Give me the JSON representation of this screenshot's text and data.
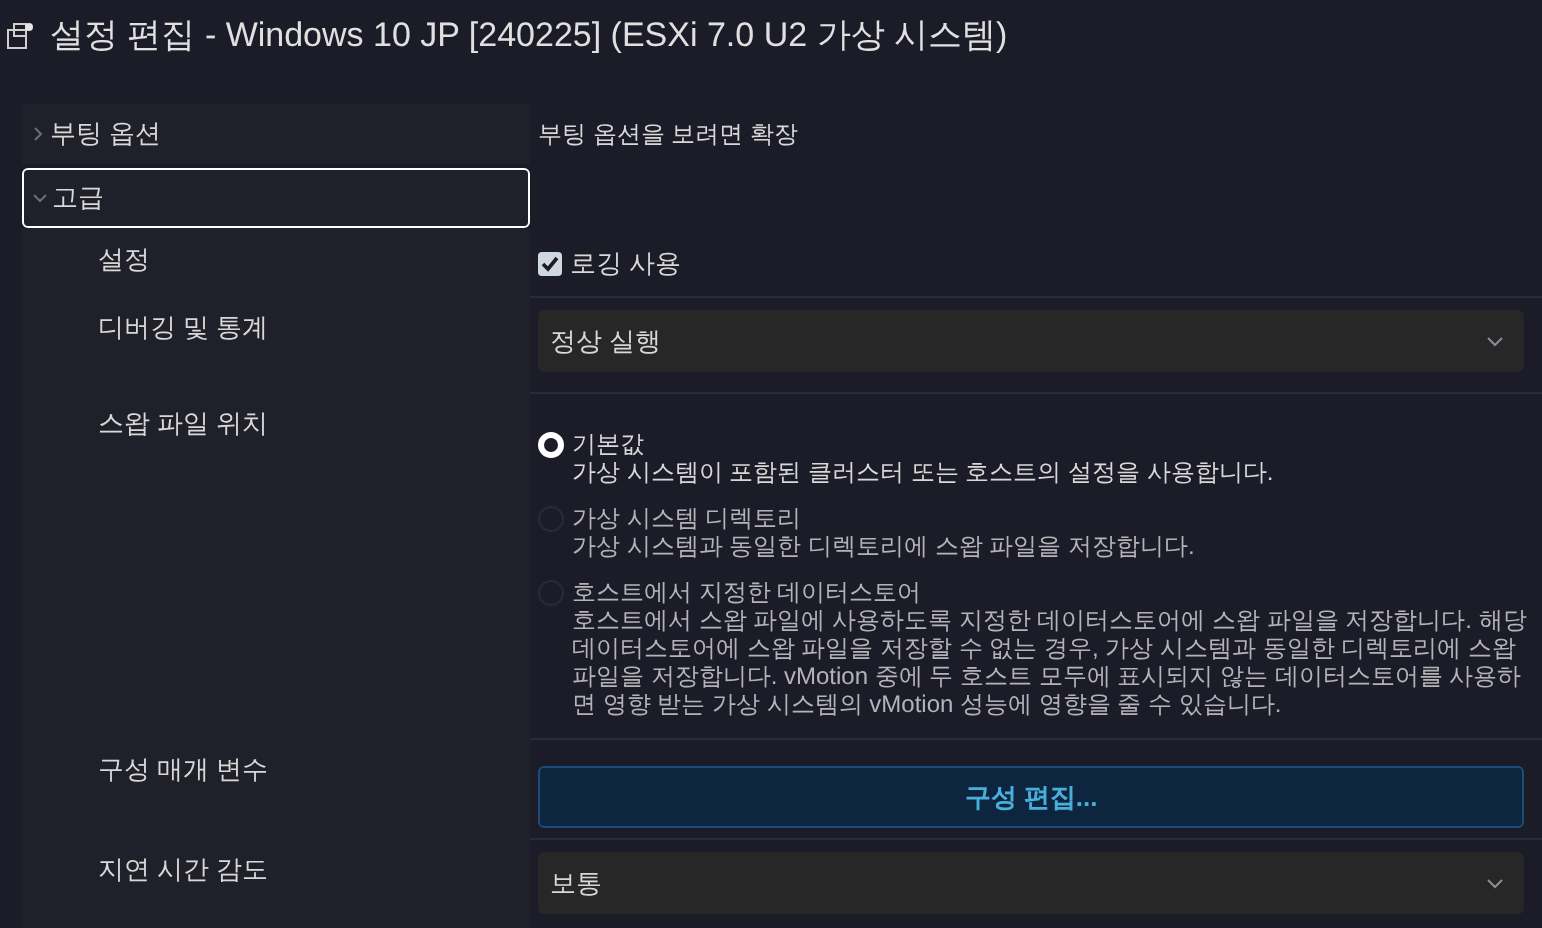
{
  "window": {
    "title": "설정 편집 - Windows 10 JP [240225] (ESXi 7.0 U2 가상 시스템)"
  },
  "sections": [
    {
      "label": "부팅 옵션",
      "expanded": false,
      "selected": false,
      "summary": "부팅 옵션을 보려면 확장"
    },
    {
      "label": "고급",
      "expanded": true,
      "selected": true
    }
  ],
  "rows": [
    {
      "kind": "checkbox",
      "label": "설정",
      "option": "로깅 사용",
      "checked": true
    },
    {
      "kind": "select",
      "label": "디버깅 및 통계",
      "value": "정상 실행"
    },
    {
      "kind": "radios",
      "label": "스왑 파일 위치",
      "options": [
        {
          "title": "기본값",
          "description": "가상 시스템이 포함된 클러스터 또는 호스트의 설정을 사용합니다.",
          "selected": true,
          "disabled": false
        },
        {
          "title": "가상 시스템 디렉토리",
          "description": "가상 시스템과 동일한 디렉토리에 스왑 파일을 저장합니다.",
          "selected": false,
          "disabled": true
        },
        {
          "title": "호스트에서 지정한 데이터스토어",
          "description": "호스트에서 스왑 파일에 사용하도록 지정한 데이터스토어에 스왑 파일을 저장합니다. 해당 데이터스토어에 스왑 파일을 저장할 수 없는 경우, 가상 시스템과 동일한 디렉토리에 스왑 파일을 저장합니다. vMotion 중에 두 호스트 모두에 표시되지 않는 데이터스토어를 사용하면 영향 받는 가상 시스템의 vMotion 성능에 영향을 줄 수 있습니다.",
          "selected": false,
          "disabled": true
        }
      ]
    },
    {
      "kind": "button",
      "label": "구성 매개 변수",
      "button": "구성 편집..."
    },
    {
      "kind": "select",
      "label": "지연 시간 감도",
      "value": "보통"
    }
  ]
}
